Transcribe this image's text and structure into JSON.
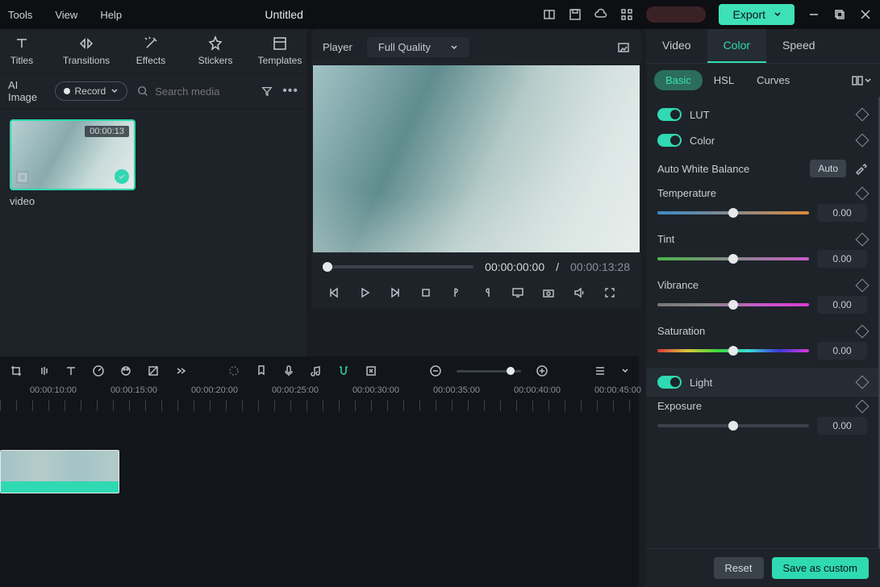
{
  "topbar": {
    "menu": [
      "Tools",
      "View",
      "Help"
    ],
    "title": "Untitled",
    "export_label": "Export"
  },
  "tooltabs": [
    "Titles",
    "Transitions",
    "Effects",
    "Stickers",
    "Templates"
  ],
  "mediabar": {
    "ai_image": "AI Image",
    "record": "Record",
    "search_placeholder": "Search media"
  },
  "thumb": {
    "duration": "00:00:13",
    "name": "video"
  },
  "preview": {
    "player_label": "Player",
    "quality": "Full Quality",
    "time_current": "00:00:00:00",
    "time_sep": "/",
    "time_total": "00:00:13:28"
  },
  "timeline": {
    "labels": [
      "00:00:10:00",
      "00:00:15:00",
      "00:00:20:00",
      "00:00:25:00",
      "00:00:30:00",
      "00:00:35:00",
      "00:00:40:00",
      "00:00:45:00"
    ]
  },
  "rpanel": {
    "tabs": {
      "video": "Video",
      "color": "Color",
      "speed": "Speed"
    },
    "subtabs": {
      "basic": "Basic",
      "hsl": "HSL",
      "curves": "Curves"
    },
    "lut": "LUT",
    "colorhead": "Color",
    "awb": "Auto White Balance",
    "auto": "Auto",
    "temperature": {
      "label": "Temperature",
      "value": "0.00"
    },
    "tint": {
      "label": "Tint",
      "value": "0.00"
    },
    "vibrance": {
      "label": "Vibrance",
      "value": "0.00"
    },
    "saturation": {
      "label": "Saturation",
      "value": "0.00"
    },
    "light": "Light",
    "exposure": {
      "label": "Exposure",
      "value": "0.00"
    },
    "reset": "Reset",
    "save": "Save as custom"
  }
}
